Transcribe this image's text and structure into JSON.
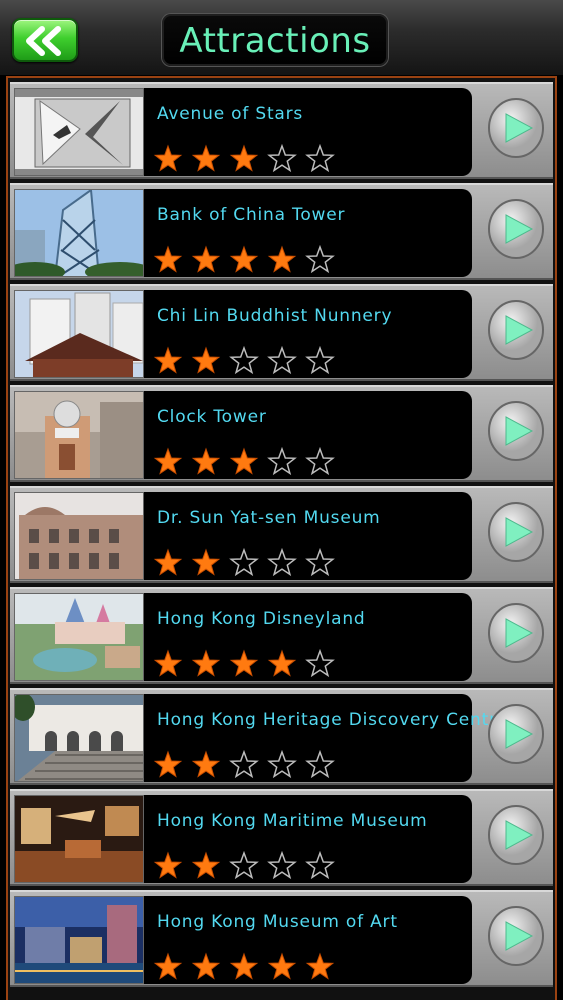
{
  "header": {
    "title": "Attractions",
    "back_icon": "double-chevron-left-icon"
  },
  "colors": {
    "accent_green": "#3fcf2e",
    "title_text": "#69f0b8",
    "name_text": "#53d9f0",
    "star_filled": "#ff7a10",
    "frame_border": "#9a4212"
  },
  "attractions": [
    {
      "name": "Avenue of Stars",
      "rating": 3,
      "max_rating": 5
    },
    {
      "name": "Bank of China Tower",
      "rating": 4,
      "max_rating": 5
    },
    {
      "name": "Chi Lin Buddhist Nunnery",
      "rating": 2,
      "max_rating": 5
    },
    {
      "name": "Clock Tower",
      "rating": 3,
      "max_rating": 5
    },
    {
      "name": "Dr. Sun Yat-sen Museum",
      "rating": 2,
      "max_rating": 5
    },
    {
      "name": "Hong Kong Disneyland",
      "rating": 4,
      "max_rating": 5
    },
    {
      "name": "Hong Kong Heritage Discovery Centre",
      "rating": 2,
      "max_rating": 5
    },
    {
      "name": "Hong Kong Maritime Museum",
      "rating": 2,
      "max_rating": 5
    },
    {
      "name": "Hong Kong Museum of Art",
      "rating": 5,
      "max_rating": 5
    }
  ]
}
